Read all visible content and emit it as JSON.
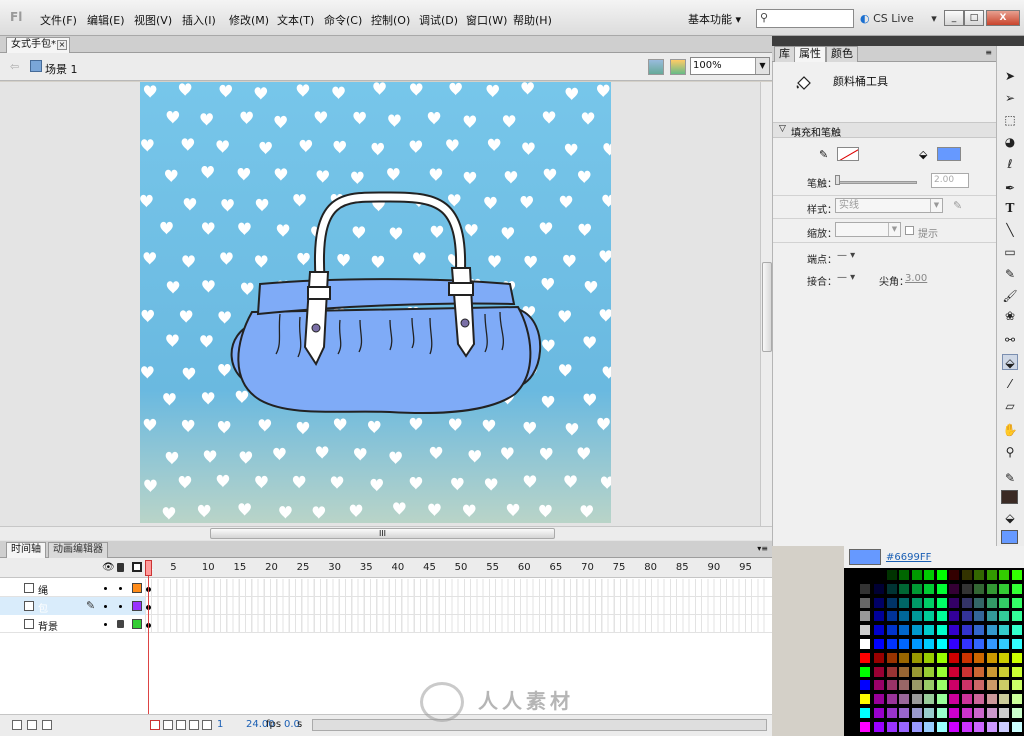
{
  "app": {
    "logo": "Fl",
    "menu": [
      "文件(F)",
      "编辑(E)",
      "视图(V)",
      "插入(I)",
      "修改(M)",
      "文本(T)",
      "命令(C)",
      "控制(O)",
      "调试(D)",
      "窗口(W)",
      "帮助(H)"
    ],
    "workspace": "基本功能",
    "cs_live": "CS Live",
    "window_buttons": [
      "_",
      "□",
      "X"
    ]
  },
  "document": {
    "tab_title": "女式手包*",
    "scene": "场景 1",
    "zoom": "100%",
    "hscroll_grip": "III"
  },
  "timeline": {
    "tabs": [
      "时间轴",
      "动画编辑器"
    ],
    "frame_numbers": [
      "1",
      "5",
      "10",
      "15",
      "20",
      "25",
      "30",
      "35",
      "40",
      "45",
      "50",
      "55",
      "60",
      "65",
      "70",
      "75",
      "80",
      "85",
      "90",
      "95"
    ],
    "layers": [
      {
        "name": "绳",
        "color": "#ff8c1a",
        "selected": false,
        "locked": false
      },
      {
        "name": "包",
        "color": "#9933ff",
        "selected": true,
        "locked": false
      },
      {
        "name": "背景",
        "color": "#33cc33",
        "selected": false,
        "locked": true
      }
    ],
    "status": {
      "frame": "1",
      "fps_value": "24.00",
      "fps_unit": "fps",
      "time_value": "0.0",
      "time_unit": "s"
    }
  },
  "properties": {
    "tabs": [
      "库",
      "属性",
      "颜色"
    ],
    "tool_name": "颜料桶工具",
    "section": "填充和笔触",
    "stroke_label": "笔触：",
    "stroke_value": "2.00",
    "style_label": "样式：",
    "style_value": "实线",
    "scale_label": "缩放：",
    "hint_label": "提示",
    "cap_label": "端点：",
    "join_label": "接合：",
    "miter_label": "尖角：",
    "miter_value": "3.00",
    "fill_color": "#6699ff"
  },
  "tools": [
    "selection-tool",
    "subselection-tool",
    "free-transform-tool",
    "3d-rotation-tool",
    "lasso-tool",
    "pen-tool",
    "text-tool",
    "line-tool",
    "rectangle-tool",
    "pencil-tool",
    "brush-tool",
    "deco-tool",
    "bone-tool",
    "paint-bucket-tool",
    "eyedropper-tool",
    "eraser-tool",
    "hand-tool",
    "zoom-tool"
  ],
  "color_picker": {
    "hex": "#6699FF",
    "swatch": "#6699ff"
  },
  "watermark": "人人素材"
}
